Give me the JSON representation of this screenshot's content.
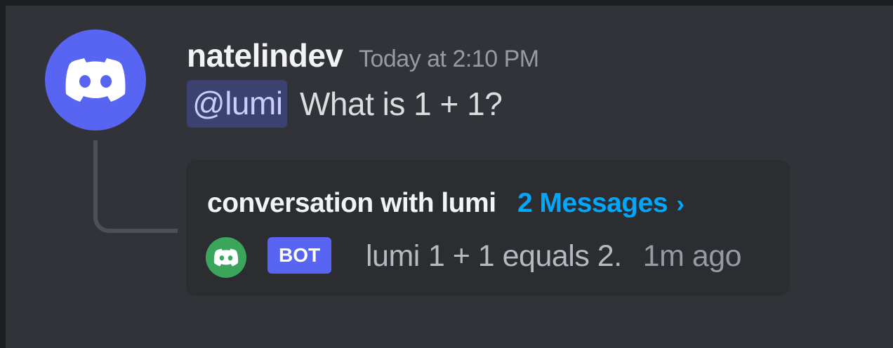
{
  "message": {
    "author": "natelindev",
    "timestamp": "Today at 2:10 PM",
    "mention": "@lumi",
    "text": "What is 1 + 1?",
    "avatar_icon": "discord-logo-icon",
    "avatar_color": "#5865f2"
  },
  "thread": {
    "name": "conversation with lumi",
    "message_count": "2 Messages",
    "chevron": "›",
    "preview": {
      "avatar_icon": "discord-logo-icon",
      "avatar_color": "#3ba55c",
      "badge": "BOT",
      "author": "lumi",
      "text": "1 + 1 equals 2.",
      "time": "1m ago"
    }
  },
  "colors": {
    "background": "#313338",
    "mention_bg": "#3c4270",
    "link": "#00a8fc",
    "bot_badge": "#5865f2"
  }
}
